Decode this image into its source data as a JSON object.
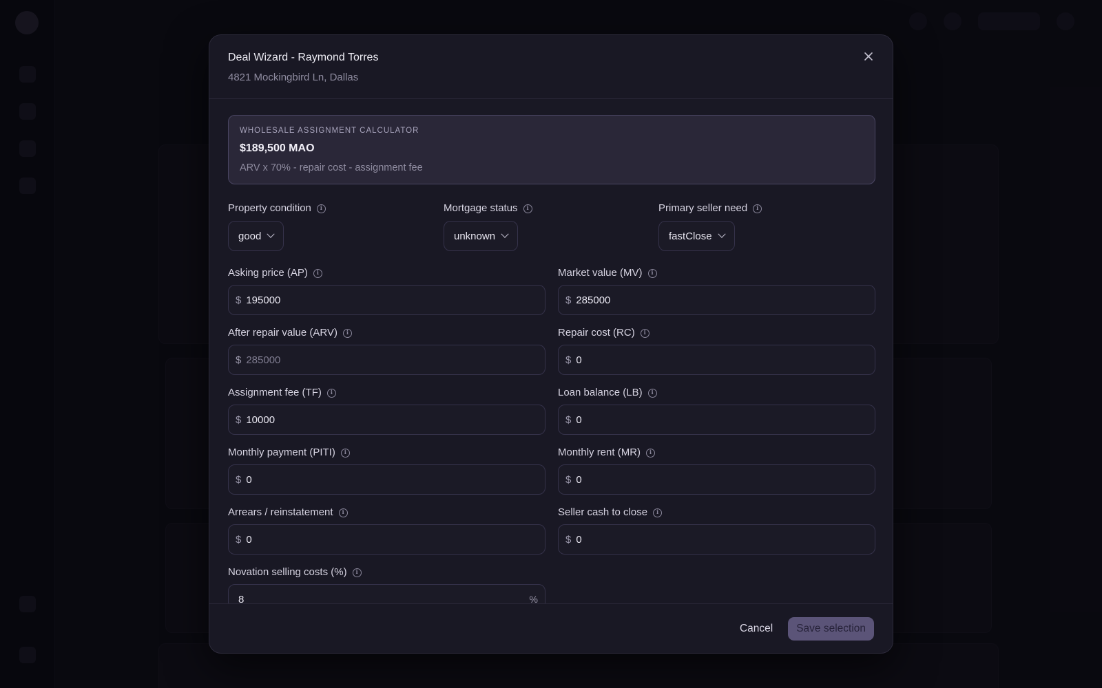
{
  "modal": {
    "title": "Deal Wizard - Raymond Torres",
    "subtitle": "4821 Mockingbird Ln, Dallas",
    "close_icon": "close-icon"
  },
  "calculator": {
    "label": "WHOLESALE ASSIGNMENT CALCULATOR",
    "value": "$189,500 MAO",
    "formula": "ARV x 70% - repair cost - assignment fee"
  },
  "selects": [
    {
      "label": "Property condition",
      "value": "good"
    },
    {
      "label": "Mortgage status",
      "value": "unknown"
    },
    {
      "label": "Primary seller need",
      "value": "fastClose"
    }
  ],
  "fields": {
    "asking_price": {
      "label": "Asking price (AP)",
      "prefix": "$",
      "value": "195000"
    },
    "market_value": {
      "label": "Market value (MV)",
      "prefix": "$",
      "value": "285000"
    },
    "arv": {
      "label": "After repair value (ARV)",
      "prefix": "$",
      "placeholder": "285000"
    },
    "repair_cost": {
      "label": "Repair cost (RC)",
      "prefix": "$",
      "value": "0"
    },
    "assignment_fee": {
      "label": "Assignment fee (TF)",
      "prefix": "$",
      "value": "10000"
    },
    "loan_balance": {
      "label": "Loan balance (LB)",
      "prefix": "$",
      "value": "0"
    },
    "monthly_payment": {
      "label": "Monthly payment (PITI)",
      "prefix": "$",
      "value": "0"
    },
    "monthly_rent": {
      "label": "Monthly rent (MR)",
      "prefix": "$",
      "value": "0"
    },
    "arrears": {
      "label": "Arrears / reinstatement",
      "prefix": "$",
      "value": "0"
    },
    "seller_cash": {
      "label": "Seller cash to close",
      "prefix": "$",
      "value": "0"
    },
    "novation_costs": {
      "label": "Novation selling costs (%)",
      "value": "8",
      "suffix": "%"
    }
  },
  "info_icon_glyph": "i",
  "footer": {
    "cancel_label": "Cancel",
    "save_label": "Save selection"
  }
}
